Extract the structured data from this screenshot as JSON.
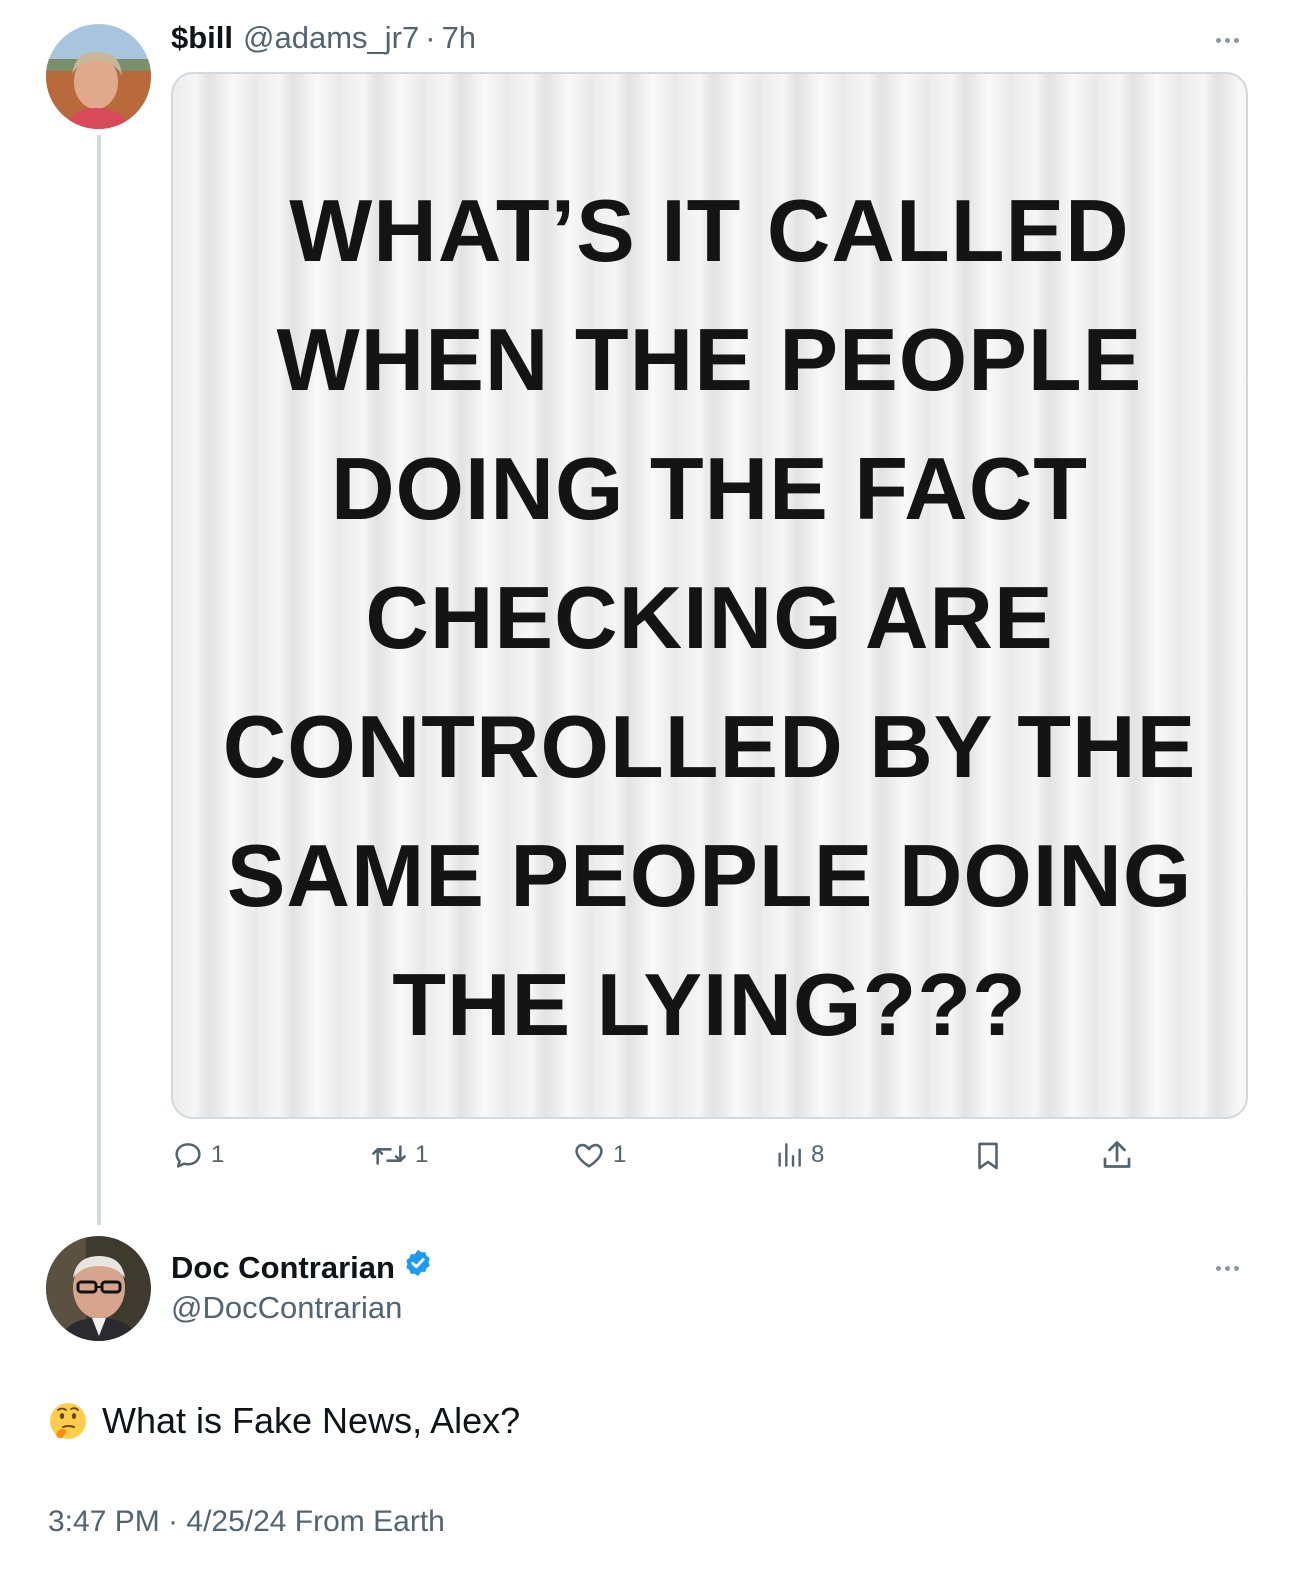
{
  "tweet1": {
    "display_name": "$bill",
    "handle": "@adams_jr7",
    "separator": "·",
    "time_ago": "7h",
    "media_lines": [
      "WHAT’S IT CALLED",
      "WHEN THE PEOPLE",
      "DOING THE FACT",
      "CHECKING ARE",
      "CONTROLLED BY THE",
      "SAME PEOPLE DOING",
      "THE LYING???"
    ],
    "actions": {
      "replies": "1",
      "reposts": "1",
      "likes": "1",
      "views": "8"
    }
  },
  "tweet2": {
    "display_name": "Doc Contrarian",
    "handle": "@DocContrarian",
    "verified": true,
    "emoji": "thinking-face",
    "text": "What is Fake News, Alex?",
    "timestamp": "3:47 PM · 4/25/24 From Earth"
  },
  "colors": {
    "text_primary": "#0f1419",
    "text_secondary": "#536471",
    "verified_blue": "#1d9bf0",
    "thread_line": "#cfd9de"
  }
}
